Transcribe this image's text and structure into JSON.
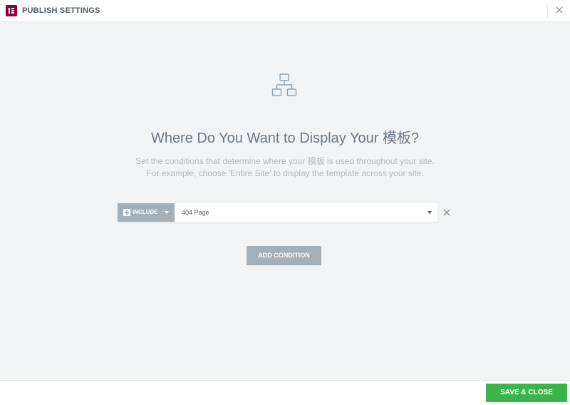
{
  "header": {
    "title": "PUBLISH SETTINGS",
    "logo_icon": "elementor-logo-icon",
    "close_icon": "close-icon",
    "brand_color": "#92003b"
  },
  "main": {
    "illustration_icon": "hierarchy-icon",
    "headline": "Where Do You Want to Display Your 模板?",
    "description_line1": "Set the conditions that determine where your 模板 is used throughout your site.",
    "description_line2": "For example, choose 'Entire Site' to display the template across your site."
  },
  "conditions": [
    {
      "type_label": "INCLUDE",
      "type_icon": "plus-square-icon",
      "value": "404 Page",
      "remove_icon": "close-icon"
    }
  ],
  "add_condition_label": "ADD CONDITION",
  "footer": {
    "save_label": "SAVE & CLOSE",
    "save_color": "#39b54a"
  }
}
